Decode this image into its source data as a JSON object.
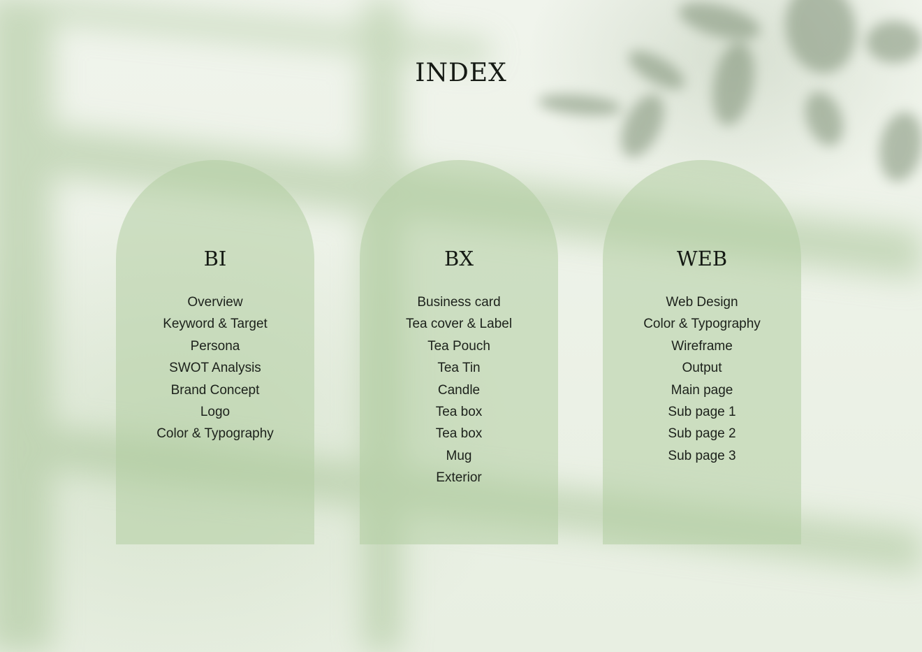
{
  "page": {
    "title": "INDEX"
  },
  "sections": [
    {
      "title": "BI",
      "items": [
        "Overview",
        "Keyword & Target",
        "Persona",
        "SWOT Analysis",
        "Brand Concept",
        "Logo",
        "Color & Typography"
      ]
    },
    {
      "title": "BX",
      "items": [
        "Business card",
        "Tea cover & Label",
        "Tea Pouch",
        "Tea Tin",
        "Candle",
        "Tea box",
        "Tea box",
        "Mug",
        "Exterior"
      ]
    },
    {
      "title": "WEB",
      "items": [
        "Web Design",
        "Color & Typography",
        "Wireframe",
        "Output",
        "Main page",
        "Sub page 1",
        "Sub page 2",
        "Sub page 3"
      ]
    }
  ],
  "colors": {
    "background": "#eef2e9",
    "arch": "#b2cea3",
    "text": "#151a14",
    "leaf_shadow": "#7d8f74"
  },
  "decorations": {
    "background_shadow": "window-frame-shadow",
    "foliage_shadow": "leaf-shadow-icon"
  }
}
